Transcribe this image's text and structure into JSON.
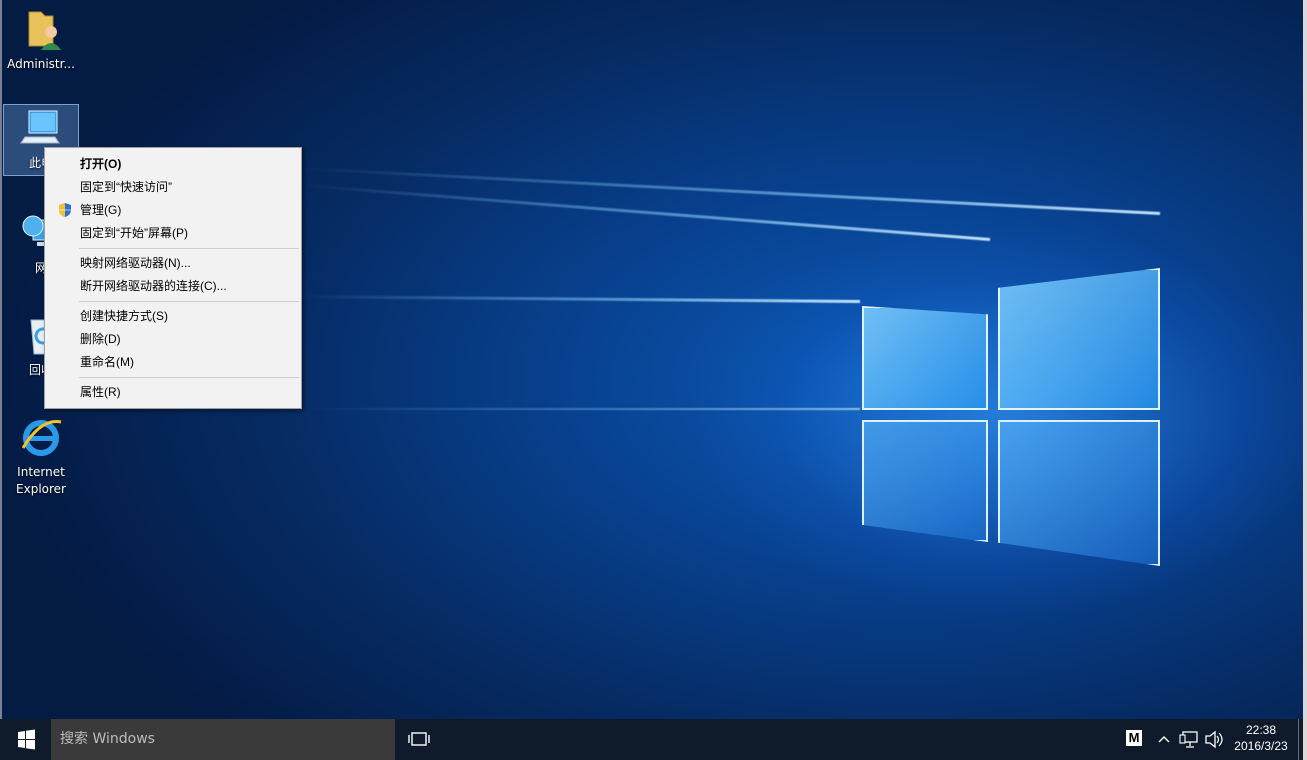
{
  "desktop": {
    "icons": [
      {
        "label": "Administr...",
        "icon": "user-folder-icon"
      },
      {
        "label": "此电",
        "icon": "this-pc-icon"
      },
      {
        "label": "网",
        "icon": "network-icon"
      },
      {
        "label": "回收",
        "icon": "recycle-bin-icon"
      },
      {
        "label_line1": "Internet",
        "label_line2": "Explorer",
        "icon": "internet-explorer-icon"
      }
    ]
  },
  "context_menu": {
    "items": [
      {
        "label": "打开(O)",
        "bold": true
      },
      {
        "label": "固定到“快速访问”"
      },
      {
        "label": "管理(G)",
        "icon": "uac-shield-icon"
      },
      {
        "label": "固定到“开始”屏幕(P)"
      },
      {
        "label": "映射网络驱动器(N)..."
      },
      {
        "label": "断开网络驱动器的连接(C)..."
      },
      {
        "label": "创建快捷方式(S)"
      },
      {
        "label": "删除(D)"
      },
      {
        "label": "重命名(M)"
      },
      {
        "label": "属性(R)"
      }
    ]
  },
  "taskbar": {
    "search_placeholder": "搜索 Windows",
    "ime_indicator": "M",
    "clock_time": "22:38",
    "clock_date": "2016/3/23"
  },
  "colors": {
    "taskbar_bg": "#0f1b2a",
    "search_bg": "#3a3a3a",
    "menu_bg": "#f2f2f2",
    "wallpaper_accent": "#0b5bb8"
  }
}
